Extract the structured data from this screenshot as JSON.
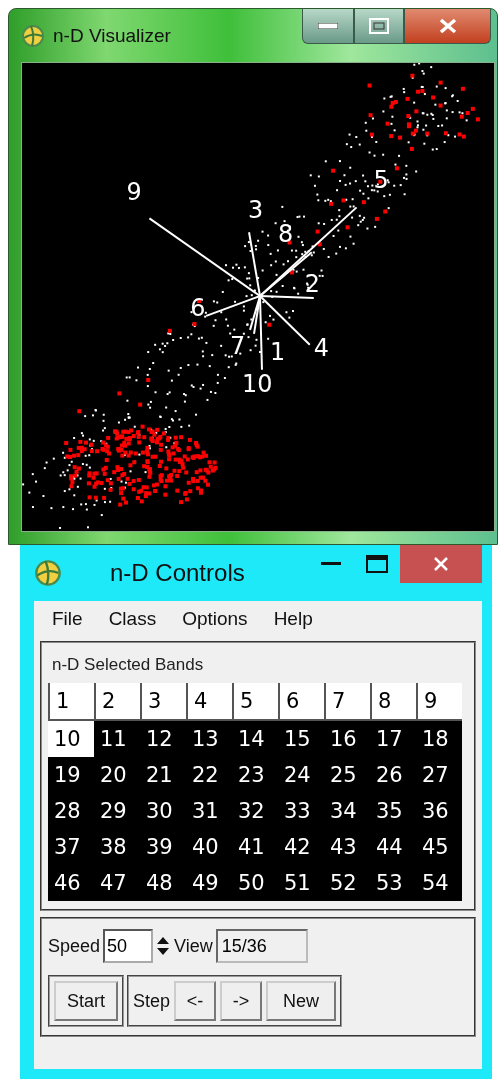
{
  "visualizer": {
    "title": "n-D Visualizer",
    "axes": [
      {
        "label": "9"
      },
      {
        "label": "3"
      },
      {
        "label": "5"
      },
      {
        "label": "8"
      },
      {
        "label": "2"
      },
      {
        "label": "6"
      },
      {
        "label": "7"
      },
      {
        "label": "1"
      },
      {
        "label": "4"
      },
      {
        "label": "10"
      }
    ]
  },
  "controls": {
    "title": "n-D Controls",
    "menu": [
      "File",
      "Class",
      "Options",
      "Help"
    ],
    "bands_group": {
      "title": "n-D Selected Bands",
      "bands": [
        {
          "label": "1",
          "selected": true
        },
        {
          "label": "2",
          "selected": true
        },
        {
          "label": "3",
          "selected": true
        },
        {
          "label": "4",
          "selected": true
        },
        {
          "label": "5",
          "selected": true
        },
        {
          "label": "6",
          "selected": true
        },
        {
          "label": "7",
          "selected": true
        },
        {
          "label": "8",
          "selected": true
        },
        {
          "label": "9",
          "selected": true
        },
        {
          "label": "10",
          "selected": true
        },
        {
          "label": "11",
          "selected": false
        },
        {
          "label": "12",
          "selected": false
        },
        {
          "label": "13",
          "selected": false
        },
        {
          "label": "14",
          "selected": false
        },
        {
          "label": "15",
          "selected": false
        },
        {
          "label": "16",
          "selected": false
        },
        {
          "label": "17",
          "selected": false
        },
        {
          "label": "18",
          "selected": false
        },
        {
          "label": "19",
          "selected": false
        },
        {
          "label": "20",
          "selected": false
        },
        {
          "label": "21",
          "selected": false
        },
        {
          "label": "22",
          "selected": false
        },
        {
          "label": "23",
          "selected": false
        },
        {
          "label": "24",
          "selected": false
        },
        {
          "label": "25",
          "selected": false
        },
        {
          "label": "26",
          "selected": false
        },
        {
          "label": "27",
          "selected": false
        },
        {
          "label": "28",
          "selected": false
        },
        {
          "label": "29",
          "selected": false
        },
        {
          "label": "30",
          "selected": false
        },
        {
          "label": "31",
          "selected": false
        },
        {
          "label": "32",
          "selected": false
        },
        {
          "label": "33",
          "selected": false
        },
        {
          "label": "34",
          "selected": false
        },
        {
          "label": "35",
          "selected": false
        },
        {
          "label": "36",
          "selected": false
        },
        {
          "label": "37",
          "selected": false
        },
        {
          "label": "38",
          "selected": false
        },
        {
          "label": "39",
          "selected": false
        },
        {
          "label": "40",
          "selected": false
        },
        {
          "label": "41",
          "selected": false
        },
        {
          "label": "42",
          "selected": false
        },
        {
          "label": "43",
          "selected": false
        },
        {
          "label": "44",
          "selected": false
        },
        {
          "label": "45",
          "selected": false
        },
        {
          "label": "46",
          "selected": false
        },
        {
          "label": "47",
          "selected": false
        },
        {
          "label": "48",
          "selected": false
        },
        {
          "label": "49",
          "selected": false
        },
        {
          "label": "50",
          "selected": false
        },
        {
          "label": "51",
          "selected": false
        },
        {
          "label": "52",
          "selected": false
        },
        {
          "label": "53",
          "selected": false
        },
        {
          "label": "54",
          "selected": false
        }
      ]
    },
    "speed": {
      "label": "Speed",
      "value": "50"
    },
    "view": {
      "label": "View",
      "value": "15/36"
    },
    "start": "Start",
    "step": {
      "label": "Step",
      "buttons": [
        "<-",
        "->",
        "New"
      ]
    }
  }
}
